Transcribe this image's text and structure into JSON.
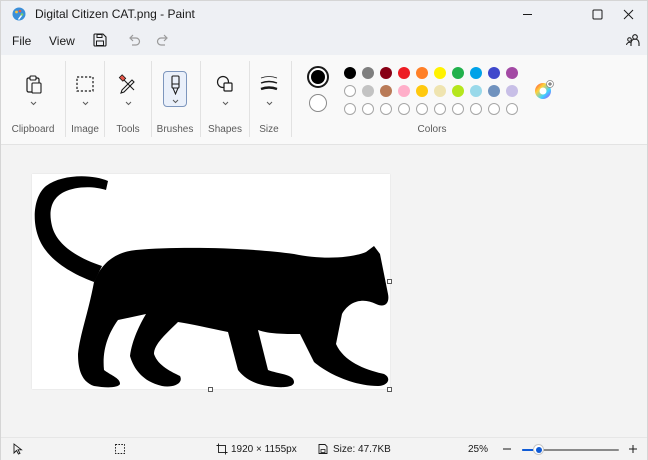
{
  "window": {
    "title": "Digital Citizen CAT.png - Paint",
    "app_icon": "paint-palette-icon",
    "controls": [
      "minimize-icon",
      "maximize-icon",
      "close-icon"
    ]
  },
  "menubar": {
    "file": "File",
    "view": "View",
    "icons": [
      "save-icon",
      "undo-icon",
      "redo-icon",
      "share-icon"
    ]
  },
  "ribbon": {
    "groups": {
      "clipboard": "Clipboard",
      "image": "Image",
      "tools": "Tools",
      "brushes": "Brushes",
      "shapes": "Shapes",
      "size": "Size",
      "colors": "Colors"
    },
    "colors": {
      "primary": "#000000",
      "secondary": "#ffffff",
      "row1": [
        "#000000",
        "#7f7f7f",
        "#880015",
        "#ed1c24",
        "#ff7f27",
        "#fff200",
        "#22b14c",
        "#00a2e8",
        "#3f48cc",
        "#a349a4"
      ],
      "row2": [
        "#ffffff",
        "#c3c3c3",
        "#b97a57",
        "#ffaec9",
        "#ffc90e",
        "#efe4b0",
        "#b5e61d",
        "#99d9ea",
        "#7092be",
        "#c8bfe7"
      ],
      "row3_custom_slots": 10,
      "edit_colors_icon": "color-wheel-icon"
    }
  },
  "canvas": {
    "image_description_icon": "black-cat-silhouette"
  },
  "statusbar": {
    "dimensions": "1920 × 1155px",
    "size": "Size: 47.7KB",
    "zoom": "25%",
    "zoom_fraction": 0.17
  }
}
